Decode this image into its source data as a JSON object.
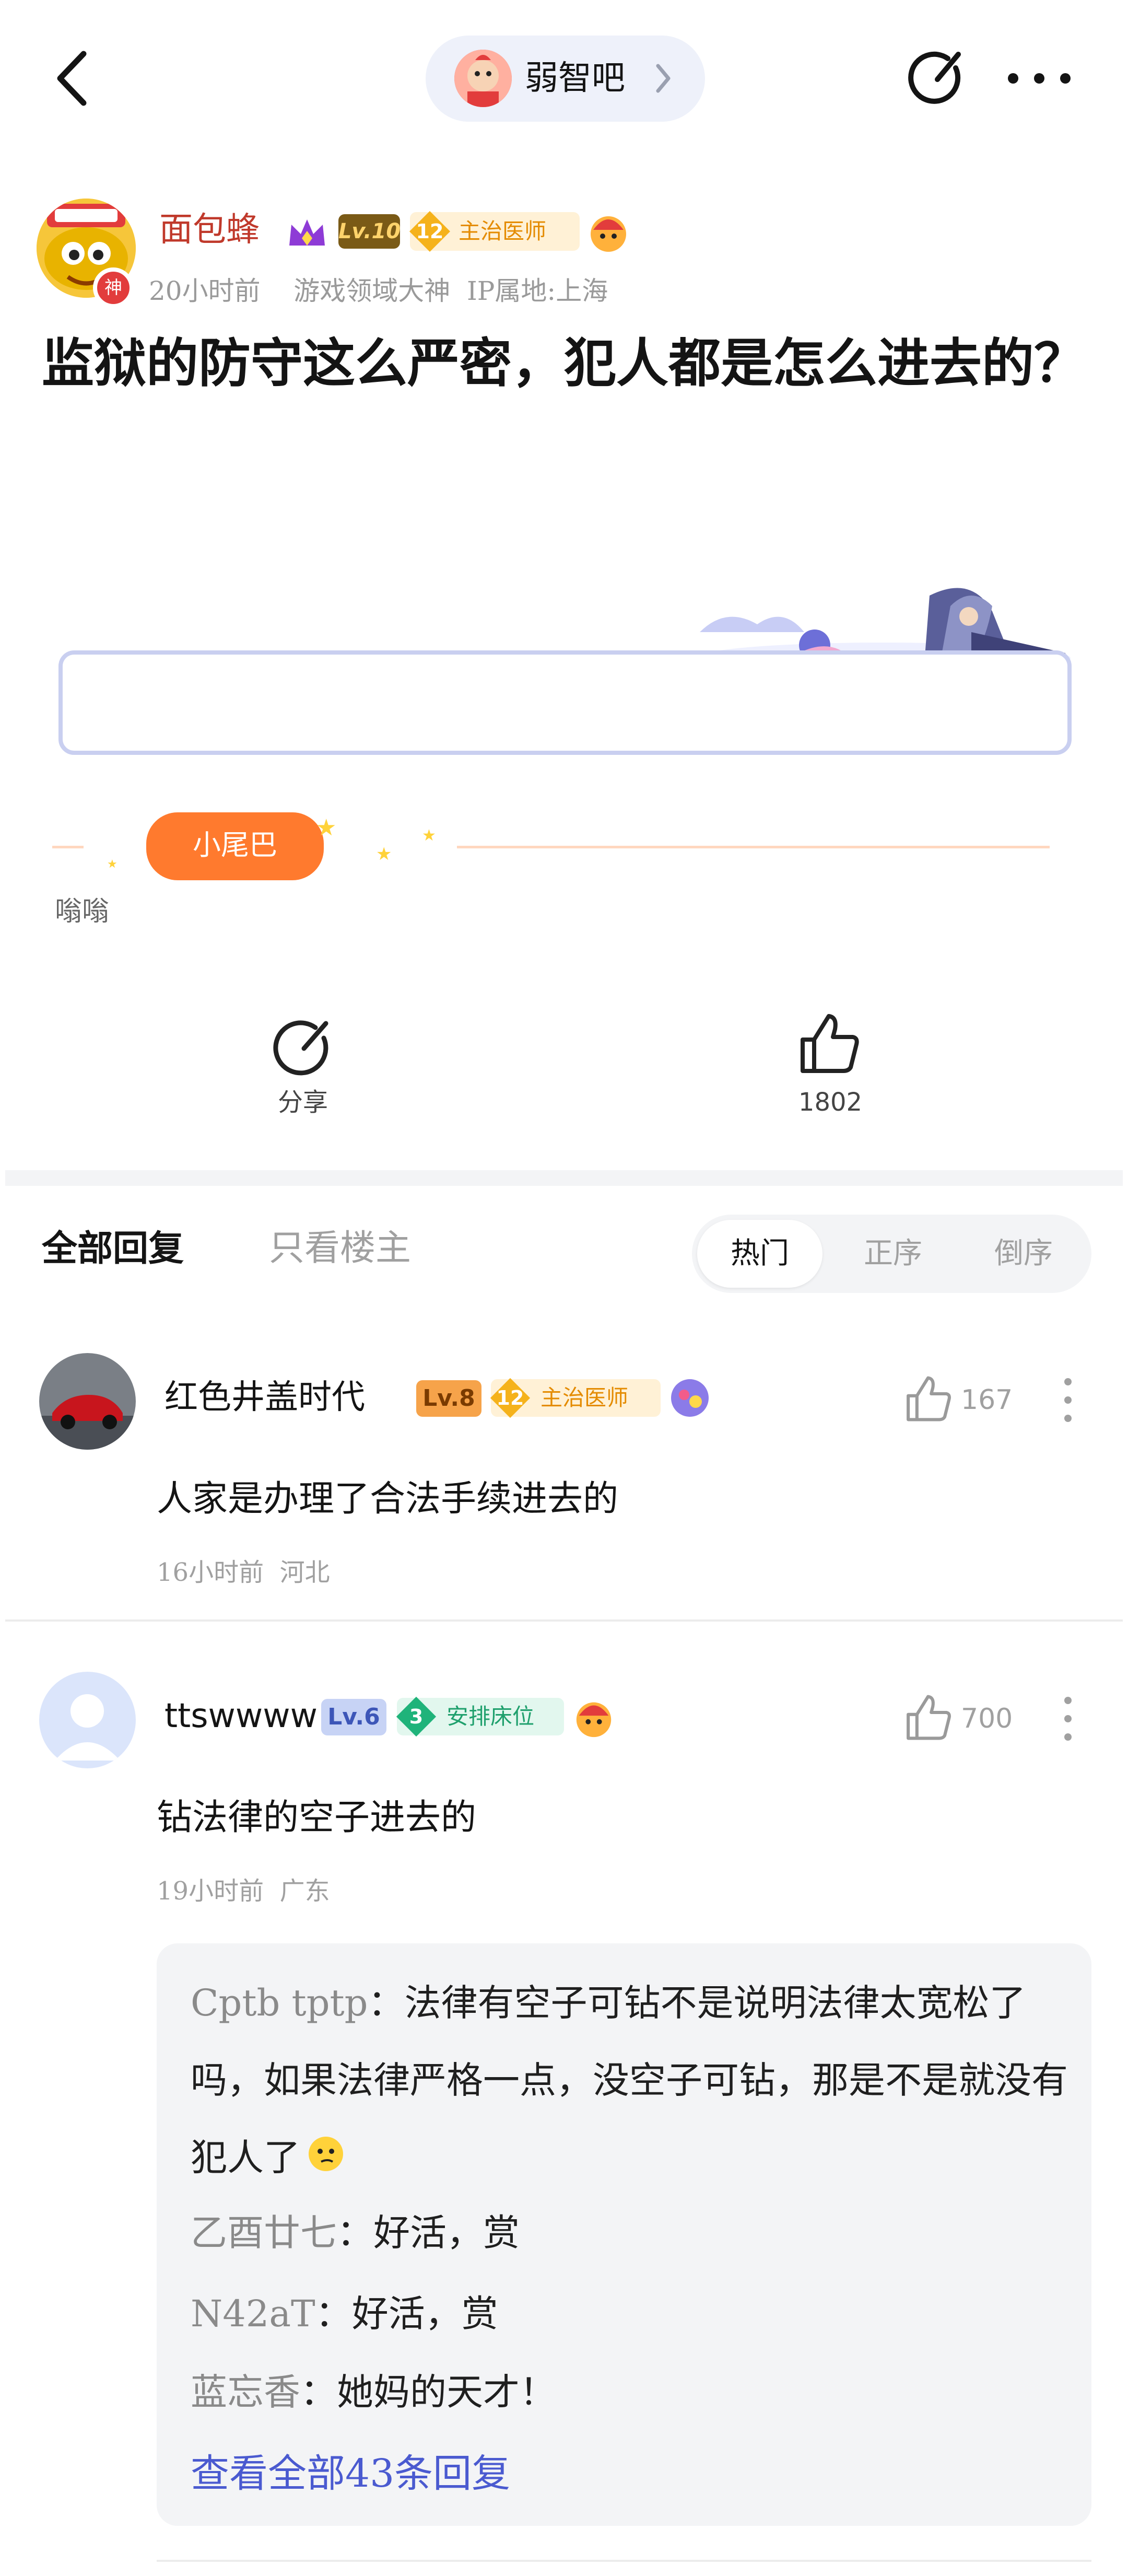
{
  "header": {
    "forum_name": "弱智吧"
  },
  "post": {
    "author": {
      "name": "面包蜂",
      "level": "Lv.10",
      "rank_num": "12",
      "rank_title": "主治医师",
      "avatar_badge": "神"
    },
    "meta": "20小时前    游戏领域大神  IP属地:上海",
    "title": "监狱的防守这么严密，犯人都是怎么进去的？",
    "tail_label": "小尾巴",
    "tail_text": "嗡嗡",
    "share_label": "分享",
    "like_count": "1802"
  },
  "tabs": {
    "all_label": "全部回复",
    "op_label": "只看楼主",
    "sort_hot": "热门",
    "sort_asc": "正序",
    "sort_desc": "倒序"
  },
  "comments": [
    {
      "name": "红色井盖时代",
      "level": "Lv.8",
      "rank_num": "12",
      "rank_title": "主治医师",
      "likes": "167",
      "body": "人家是办理了合法手续进去的",
      "meta": "16小时前  河北"
    },
    {
      "name": "ttswwww",
      "level": "Lv.6",
      "rank_num": "3",
      "rank_title": "安排床位",
      "likes": "700",
      "body": "钻法律的空子进去的",
      "meta": "19小时前  广东",
      "replies": [
        {
          "author": "Cptb tptp",
          "text": "法律有空子可钻不是说明法律太宽松了吗，如果法律严格一点，没空子可钻，那是不是就没有犯人了"
        },
        {
          "author": "乙酉廿七",
          "text": "好活，赏"
        },
        {
          "author": "N42aT",
          "text": "好活，赏"
        },
        {
          "author": "蓝忘香",
          "text": "她妈的天才！"
        }
      ],
      "view_all": "查看全部43条回复"
    }
  ],
  "colors": {
    "accent_blue": "#4a5ad0",
    "author_red": "#c0392b",
    "rank_orange": "#e48b00",
    "rank_green": "#1fb37a",
    "tail_orange": "#ff7a2e"
  },
  "icons": [
    "back-icon",
    "chevron-right-icon",
    "edit-icon",
    "more-icon",
    "share-icon",
    "thumbs-up-icon"
  ]
}
